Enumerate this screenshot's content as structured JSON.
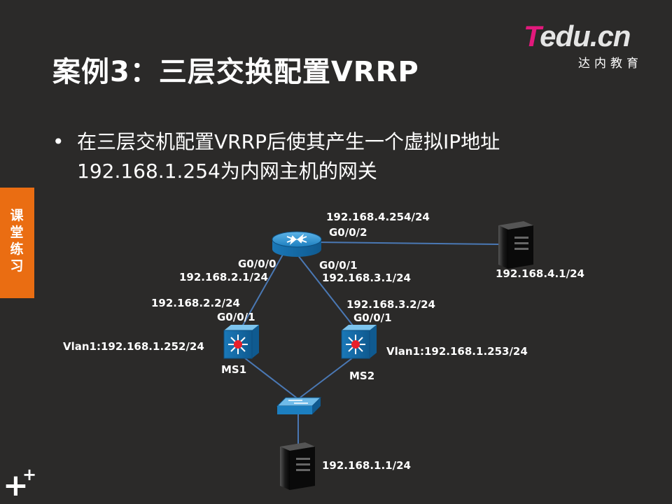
{
  "slide": {
    "title": "案例3：三层交换配置VRRP",
    "bullet": "在三层交机配置VRRP后使其产生一个虚拟IP地址192.168.1.254为内网主机的网关",
    "bullet_symbol": "•",
    "side_tab": "课堂练习"
  },
  "logo": {
    "brand_t": "T",
    "brand_rest": "edu.cn",
    "subtitle": "达内教育"
  },
  "diagram": {
    "router": {
      "g002_ip": "192.168.4.254/24",
      "g002_port": "G0/0/2",
      "g000_port": "G0/0/0",
      "g000_ip": "192.168.2.1/24",
      "g001_port": "G0/0/1",
      "g001_ip": "192.168.3.1/24"
    },
    "server_top": {
      "ip": "192.168.4.1/24"
    },
    "ms1": {
      "name": "MS1",
      "uplink_ip": "192.168.2.2/24",
      "uplink_port": "G0/0/1",
      "vlan": "Vlan1:192.168.1.252/24"
    },
    "ms2": {
      "name": "MS2",
      "uplink_ip": "192.168.3.2/24",
      "uplink_port": "G0/0/1",
      "vlan": "Vlan1:192.168.1.253/24"
    },
    "server_bottom": {
      "ip": "192.168.1.1/24"
    },
    "colors": {
      "link": "#4a78b4",
      "device_blue": "#1f8fd0",
      "server_dark": "#1a1a1a",
      "accent_orange": "#ea6d12",
      "logo_pink": "#e2197c"
    }
  }
}
